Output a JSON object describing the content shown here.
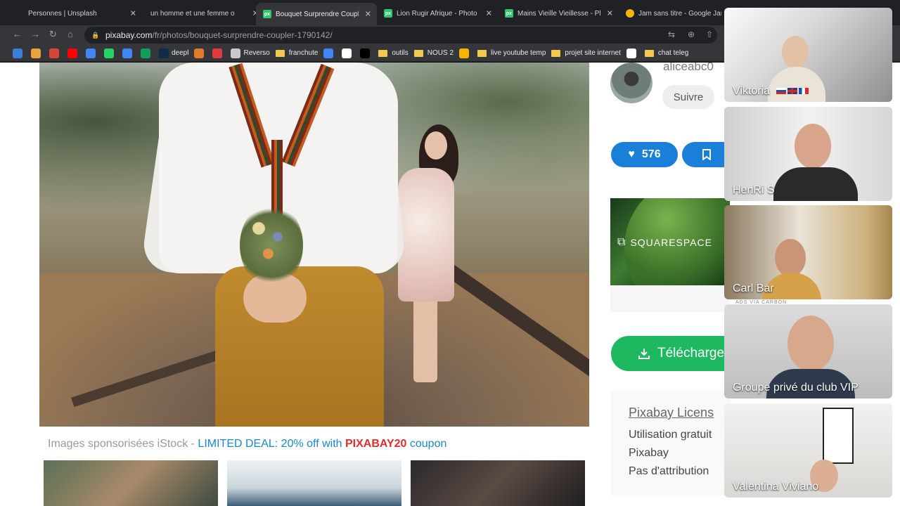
{
  "browser": {
    "tabs": [
      {
        "title": "Personnes | Unsplash",
        "favicon_color": "#202124",
        "favicon_glyph": ""
      },
      {
        "title": "un homme et une femme o",
        "favicon_color": "#202124",
        "favicon_glyph": ""
      },
      {
        "title": "Bouquet Surprendre Couple",
        "favicon_color": "#2ec66e",
        "favicon_glyph": "px",
        "active": true
      },
      {
        "title": "Lion Rugir Afrique - Photo",
        "favicon_color": "#2ec66e",
        "favicon_glyph": "px"
      },
      {
        "title": "Mains Vieille Vieillesse - Ph",
        "favicon_color": "#2ec66e",
        "favicon_glyph": "px"
      },
      {
        "title": "Jam sans titre - Google Jam",
        "favicon_color": "#f4b400",
        "favicon_glyph": ""
      }
    ],
    "close_glyph": "✕",
    "url_host": "pixabay.com",
    "url_path": "/fr/photos/bouquet-surprendre-coupler-1790142/",
    "bookmarks": [
      {
        "label": "",
        "color": "#3b7dd8"
      },
      {
        "label": "",
        "color": "#e8a33a"
      },
      {
        "label": "",
        "color": "#d44638"
      },
      {
        "label": "",
        "color": "#ff0000"
      },
      {
        "label": "",
        "color": "#4285f4"
      },
      {
        "label": "",
        "color": "#25d366"
      },
      {
        "label": "",
        "color": "#4285f4"
      },
      {
        "label": "",
        "color": "#0f9d58"
      },
      {
        "label": "deepl",
        "color": "#0f2b46"
      },
      {
        "label": "",
        "color": "#e07b2a"
      },
      {
        "label": "",
        "color": "#e03a3a"
      },
      {
        "label": "Reverso",
        "color": "#c9c9c9"
      },
      {
        "label": "franchute",
        "folder": true
      },
      {
        "label": "",
        "color": "#4285f4"
      },
      {
        "label": "",
        "color": "#ffffff"
      },
      {
        "label": "",
        "color": "#000000"
      },
      {
        "label": "outils",
        "folder": true
      },
      {
        "label": "NOUS 2",
        "folder": true
      },
      {
        "label": "",
        "color": "#f4b400"
      },
      {
        "label": "live youtube temp",
        "folder": true
      },
      {
        "label": "projet site internet",
        "folder": true
      },
      {
        "label": "",
        "color": "#ffffff"
      },
      {
        "label": "chat teleg",
        "folder": true
      }
    ]
  },
  "page": {
    "sponsored_prefix": "Images sponsorisées iStock - ",
    "sponsored_deal": "LIMITED DEAL: 20% off with ",
    "sponsored_code": "PIXABAY20",
    "sponsored_suffix": " coupon",
    "author": {
      "name": "aliceabc0",
      "follow_label": "Suivre"
    },
    "like_count": "576",
    "ad_brand": "SQUARESPACE",
    "ads_via": "ADS VIA CARBON",
    "download_label": "Télécharge",
    "license": {
      "title": "Pixabay Licens",
      "lines": [
        "Utilisation gratuit",
        "Pixabay",
        "Pas d'attribution"
      ]
    }
  },
  "participants": [
    {
      "name": "Viktoria",
      "flags": [
        "ru",
        "uk",
        "fr"
      ]
    },
    {
      "name": "HenRi S"
    },
    {
      "name": "Carl Bar"
    },
    {
      "name": "Groupe privé du club VIP"
    },
    {
      "name": "Valentina Viviano"
    }
  ],
  "colors": {
    "pixabay_blue": "#1a7fd8",
    "pixabay_green": "#1db85f",
    "deal_blue": "#1a88c9",
    "code_red": "#e02d2d"
  }
}
